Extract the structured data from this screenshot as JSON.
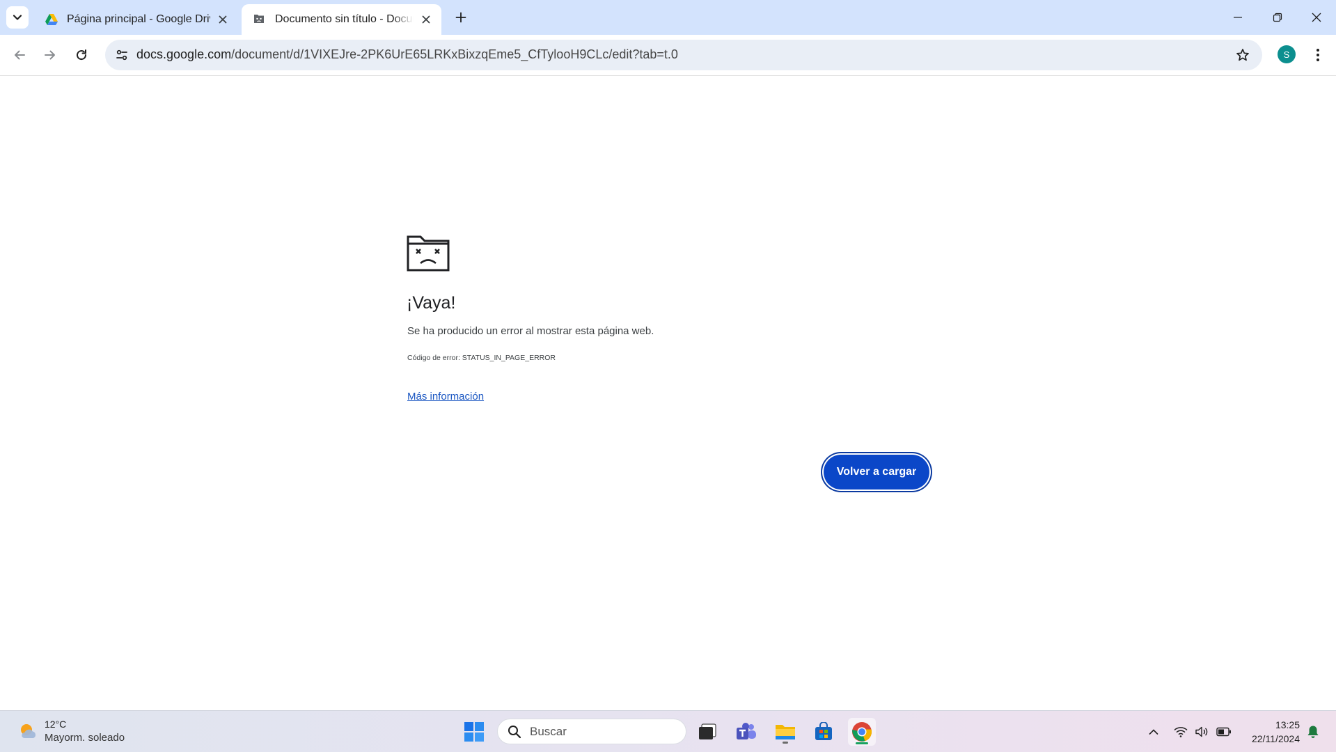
{
  "browser": {
    "tabs": [
      {
        "title": "Página principal - Google Drive",
        "favicon": "google-drive-icon",
        "active": false
      },
      {
        "title": "Documento sin título - Documentos de Google",
        "favicon": "docs-crashed-icon",
        "active": true
      }
    ],
    "url_host": "docs.google.com",
    "url_path": "/document/d/1VIXEJre-2PK6UrE65LRKxBixzqEme5_CfTylooH9CLc/edit?tab=t.0",
    "profile_initial": "S",
    "profile_color": "#0c8f8f"
  },
  "error_page": {
    "heading": "¡Vaya!",
    "message": "Se ha producido un error al mostrar esta página web.",
    "error_code": "Código de error: STATUS_IN_PAGE_ERROR",
    "more_info_link": "Más información",
    "reload_button": "Volver a cargar",
    "accent_color": "#0b47c8"
  },
  "taskbar": {
    "weather_temp": "12°C",
    "weather_condition": "Mayorm. soleado",
    "search_placeholder": "Buscar",
    "time": "13:25",
    "date": "22/11/2024",
    "pinned_apps": [
      "start-icon",
      "task-view-icon",
      "teams-icon",
      "file-explorer-icon",
      "microsoft-store-icon",
      "chrome-icon"
    ]
  }
}
